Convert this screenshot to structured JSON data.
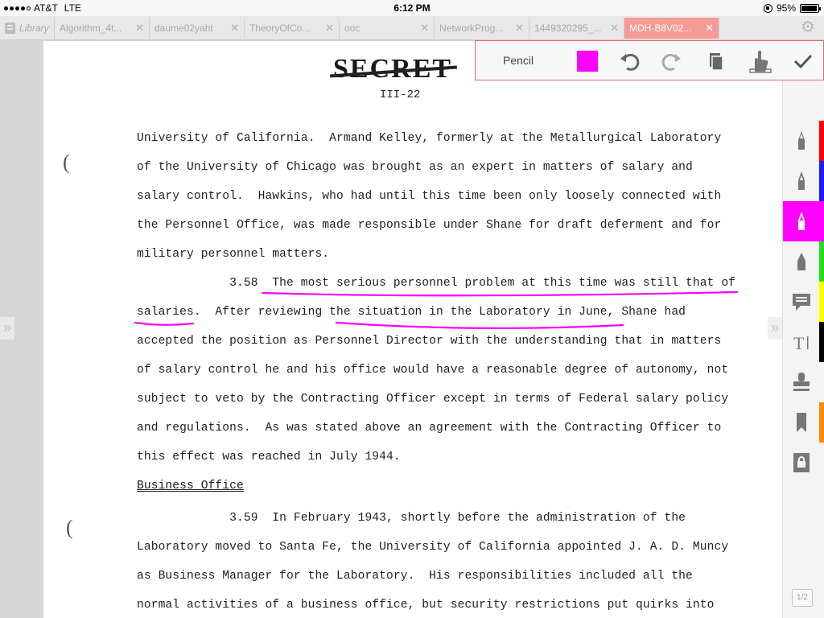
{
  "status_bar": {
    "carrier": "AT&T",
    "network": "LTE",
    "time": "6:12 PM",
    "battery": "95%",
    "battery_level": 0.95
  },
  "tabs": [
    {
      "label": "Library"
    },
    {
      "label": "Algorithm_4t..."
    },
    {
      "label": "daume02yaht"
    },
    {
      "label": "TheoryOfCo..."
    },
    {
      "label": "ooc"
    },
    {
      "label": "NetworkProg..."
    },
    {
      "label": "1449320295_..."
    },
    {
      "label": "MDH-B8V02...",
      "active": true
    }
  ],
  "annotation_toolbar": {
    "tool_name": "Pencil",
    "color": "#ff00ff",
    "buttons": [
      "undo-icon",
      "redo-icon",
      "copy-icon",
      "palm-rest-icon",
      "checkmark-icon"
    ]
  },
  "document": {
    "stamp": "SECRET",
    "page_number": "III-22",
    "lines": [
      "University of California.  Armand Kelley, formerly at the Metallurgical Laboratory",
      "of the University of Chicago was brought as an expert in matters of salary and",
      "salary control.  Hawkins, who had until this time been only loosely connected with",
      "the Personnel Office, was made responsible under Shane for draft deferment and for",
      "military personnel matters.",
      "             3.58  The most serious personnel problem at this time was still that of",
      "salaries.  After reviewing the situation in the Laboratory in June, Shane had",
      "accepted the position as Personnel Director with the understanding that in matters",
      "of salary control he and his office would have a reasonable degree of autonomy, not",
      "subject to veto by the Contracting Officer except in terms of Federal salary policy",
      "and regulations.  As was stated above an agreement with the Contracting Officer to",
      "this effect was reached in July 1944.",
      "",
      "             3.59  In February 1943, shortly before the administration of the",
      "Laboratory moved to Santa Fe, the University of California appointed J. A. D. Muncy",
      "as Business Manager for the Laboratory.  His responsibilities included all the",
      "normal activities of a business office, but security restrictions put quirks into"
    ],
    "heading": "Business Office"
  },
  "right_rail": {
    "tools": [
      "pen-red-icon",
      "pen-blue-icon",
      "pencil-icon",
      "highlighter-icon",
      "comment-icon",
      "text-icon",
      "stamp-icon",
      "bookmark-icon",
      "lock-icon"
    ],
    "strip_colors": [
      "#ff0000",
      "#1a1aff",
      "#ff00ff",
      "#22dd22",
      "#ffff00",
      "#000000",
      "#ff8800"
    ]
  },
  "page_indicator": "1/2"
}
